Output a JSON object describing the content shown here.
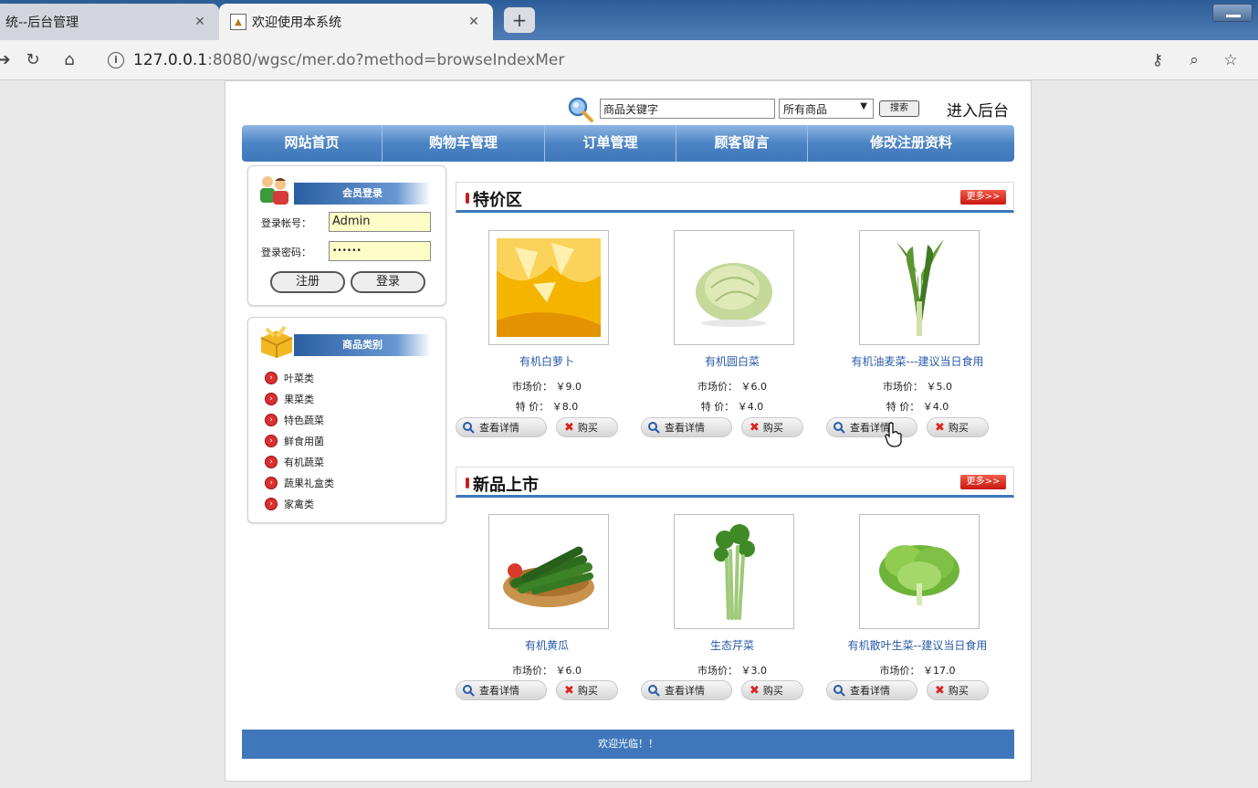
{
  "browser": {
    "tabs": [
      {
        "title": "统--后台管理",
        "close": "✕"
      },
      {
        "title": "欢迎使用本系统",
        "close": "✕"
      }
    ],
    "new_tab": "+",
    "url_host": "127.0.0.1",
    "url_rest": ":8080/wgsc/mer.do?method=browseIndexMer",
    "icons": [
      "back-icon",
      "reload-icon",
      "home-icon",
      "key-icon",
      "zoom-icon",
      "star-icon"
    ]
  },
  "search": {
    "placeholder": "商品关键字",
    "scope": "所有商品",
    "button": "搜索",
    "admin_link": "进入后台"
  },
  "nav": [
    "网站首页",
    "购物车管理",
    "订单管理",
    "顾客留言",
    "修改注册资料"
  ],
  "login": {
    "title": "会员登录",
    "account_label": "登录帐号：",
    "account_value": "Admin",
    "password_label": "登录密码：",
    "password_value": "••••••",
    "register": "注册",
    "login": "登录"
  },
  "categories": {
    "title": "商品类别",
    "items": [
      "叶菜类",
      "果菜类",
      "特色蔬菜",
      "鲜食用菌",
      "有机蔬菜",
      "蔬果礼盒类",
      "家禽类"
    ]
  },
  "sections": {
    "special": {
      "title": "特价区",
      "more": "更多>>",
      "products": [
        {
          "name": "有机白萝卜",
          "market": "市场价：  ￥9.0",
          "special": "特  价：  ￥8.0"
        },
        {
          "name": "有机圆白菜",
          "market": "市场价：  ￥6.0",
          "special": "特  价：  ￥4.0"
        },
        {
          "name": "有机油麦菜---建议当日食用",
          "market": "市场价：  ￥5.0",
          "special": "特  价：  ￥4.0"
        }
      ]
    },
    "new": {
      "title": "新品上市",
      "more": "更多>>",
      "products": [
        {
          "name": "有机黄瓜",
          "market": "市场价：  ￥6.0"
        },
        {
          "name": "生态芹菜",
          "market": "市场价：  ￥3.0"
        },
        {
          "name": "有机散叶生菜--建议当日食用",
          "market": "市场价：  ￥17.0"
        }
      ]
    },
    "detail_button": "查看详情",
    "buy_button": "购买"
  },
  "footer": "欢迎光临！！",
  "colors": {
    "nav_blue": "#3f77ba",
    "more_red": "#d8261b",
    "link_blue": "#2a5aa8",
    "field_yellow": "#fdfdc8"
  }
}
